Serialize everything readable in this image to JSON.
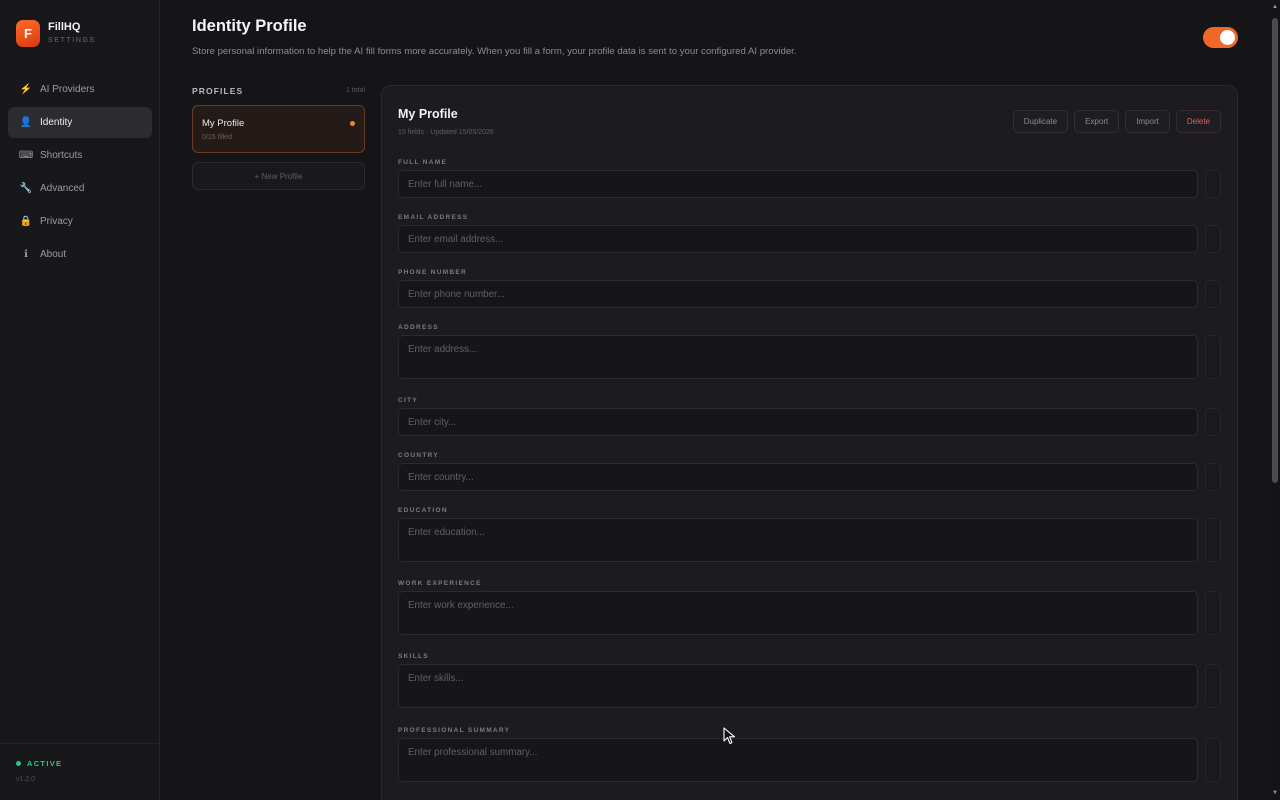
{
  "app": {
    "name": "FillHQ",
    "subtitle": "SETTINGS",
    "logo_letter": "F",
    "accent": "#f0672a"
  },
  "sidebar": {
    "items": [
      {
        "label": "AI Providers",
        "icon": "lightning-icon",
        "glyph": "⚡",
        "active": false
      },
      {
        "label": "Identity",
        "icon": "user-icon",
        "glyph": "👤",
        "active": true
      },
      {
        "label": "Shortcuts",
        "icon": "keyboard-icon",
        "glyph": "⌨",
        "active": false
      },
      {
        "label": "Advanced",
        "icon": "wrench-icon",
        "glyph": "🔧",
        "active": false
      },
      {
        "label": "Privacy",
        "icon": "lock-icon",
        "glyph": "🔒",
        "active": false
      },
      {
        "label": "About",
        "icon": "info-icon",
        "glyph": "ℹ",
        "active": false
      }
    ],
    "status": "ACTIVE",
    "version": "v1.2.0"
  },
  "header": {
    "title": "Identity Profile",
    "description": "Store personal information to help the AI fill forms more accurately. When you fill a form, your profile data is sent to your configured AI provider.",
    "toggle_on": true
  },
  "profiles": {
    "label": "PROFILES",
    "count": "1 total",
    "list": [
      {
        "name": "My Profile",
        "filled": "0/15 filled"
      }
    ],
    "new_label": "+ New Profile"
  },
  "main": {
    "title": "My Profile",
    "meta": "15 fields · Updated 15/05/2026",
    "actions": {
      "duplicate": "Duplicate",
      "export": "Export",
      "import": "Import",
      "delete": "Delete"
    },
    "fields": [
      {
        "label": "FULL NAME",
        "placeholder": "Enter full name...",
        "multiline": false
      },
      {
        "label": "EMAIL ADDRESS",
        "placeholder": "Enter email address...",
        "multiline": false
      },
      {
        "label": "PHONE NUMBER",
        "placeholder": "Enter phone number...",
        "multiline": false
      },
      {
        "label": "ADDRESS",
        "placeholder": "Enter address...",
        "multiline": true
      },
      {
        "label": "CITY",
        "placeholder": "Enter city...",
        "multiline": false
      },
      {
        "label": "COUNTRY",
        "placeholder": "Enter country...",
        "multiline": false
      },
      {
        "label": "EDUCATION",
        "placeholder": "Enter education...",
        "multiline": true
      },
      {
        "label": "WORK EXPERIENCE",
        "placeholder": "Enter work experience...",
        "multiline": true
      },
      {
        "label": "SKILLS",
        "placeholder": "Enter skills...",
        "multiline": true
      },
      {
        "label": "PROFESSIONAL SUMMARY",
        "placeholder": "Enter professional summary...",
        "multiline": true
      }
    ]
  }
}
